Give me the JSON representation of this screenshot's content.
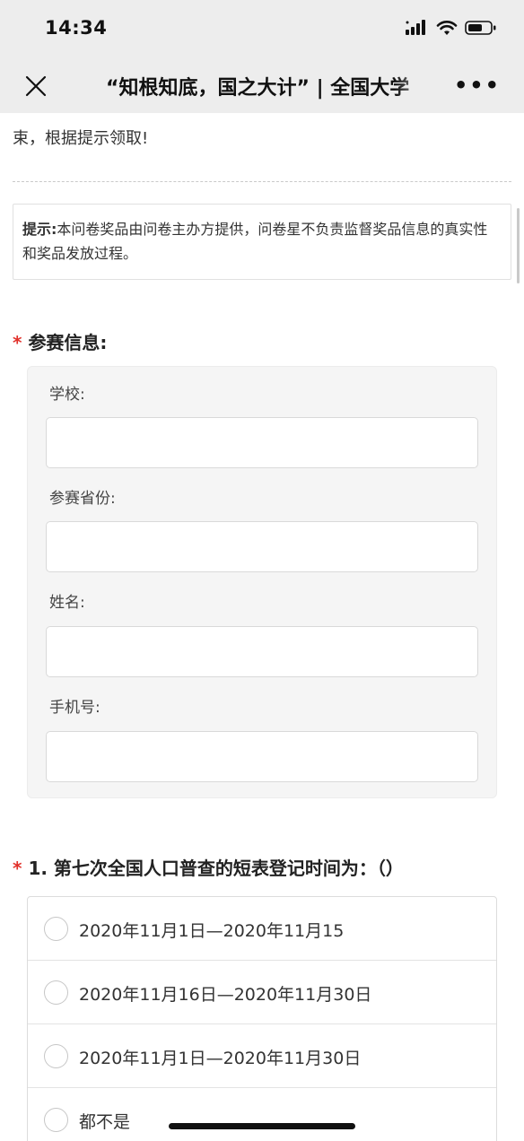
{
  "status_bar": {
    "time": "14:34"
  },
  "nav": {
    "title": "“知根知底，国之大计” | 全国大学"
  },
  "intro": {
    "tail_text": "束，根据提示领取!"
  },
  "tip": {
    "label": "提示:",
    "text": "本问卷奖品由问卷主办方提供，问卷星不负责监督奖品信息的真实性和奖品发放过程。"
  },
  "contest_info": {
    "required_mark": "*",
    "title": "参赛信息:",
    "fields": [
      {
        "label": "学校:",
        "value": ""
      },
      {
        "label": "参赛省份:",
        "value": ""
      },
      {
        "label": "姓名:",
        "value": ""
      },
      {
        "label": "手机号:",
        "value": ""
      }
    ]
  },
  "question1": {
    "required_mark": "*",
    "title": "1. 第七次全国人口普查的短表登记时间为：（）",
    "options": [
      "2020年11月1日—2020年11月15",
      "2020年11月16日—2020年11月30日",
      "2020年11月1日—2020年11月30日",
      "都不是"
    ]
  },
  "colors": {
    "required": "#e1312b",
    "header_bg": "#ededed"
  }
}
